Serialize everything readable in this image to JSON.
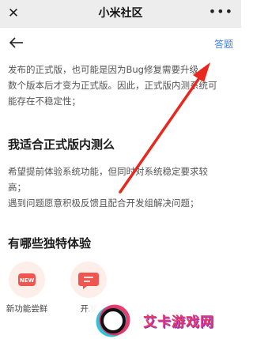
{
  "topbar": {
    "close_glyph": "✕",
    "title": "小米社区",
    "more_glyph": "•••"
  },
  "navbar": {
    "back_icon": "arrow-left-icon",
    "answer_label": "答题"
  },
  "intro_lines": [
    "发布的正式版，也可能是因为Bug修复需要升级",
    "数个版本后才变为正式版。因此，正式版内测系统可",
    "能存在不稳定性；"
  ],
  "section1": {
    "heading": "我适合正式版内测么",
    "lines": [
      "希望提前体验系统功能，但同时对系统稳定要求较",
      "高；",
      "遇到问题愿意积极反馈且配合开发组解决问题；"
    ]
  },
  "section2": {
    "heading": "有哪些独特体验",
    "features": [
      {
        "badge": "NEW",
        "label": "新功能尝鲜",
        "icon": "new-badge-icon"
      },
      {
        "badge": "",
        "label": "开发",
        "icon": "chat-bubble-icon"
      }
    ]
  },
  "annotation": {
    "color": "#e8281e",
    "icon": "red-arrow-icon"
  },
  "watermark": {
    "text": "艾卡游戏网",
    "icon": "watermark-logo-icon"
  },
  "colors": {
    "accent_blue": "#3f7fe0",
    "feature_red": "#f0564f",
    "feature_bg": "#fdeeea"
  }
}
